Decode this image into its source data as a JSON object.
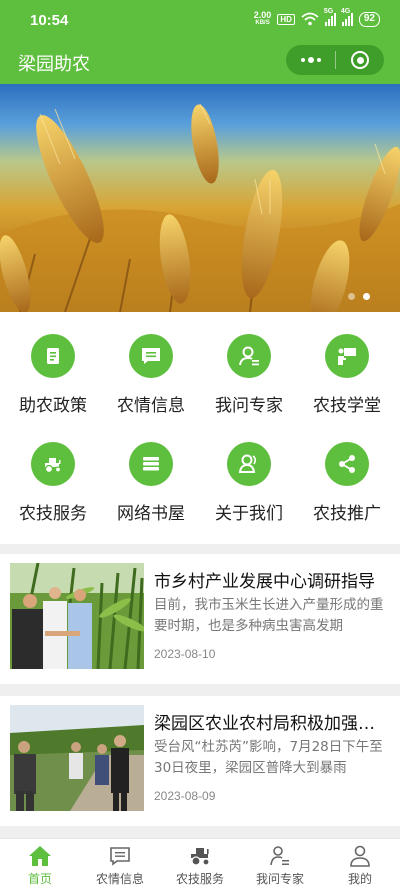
{
  "status_bar": {
    "time": "10:54",
    "speed_value": "2.00",
    "speed_unit": "KB/S",
    "hd_label": "HD",
    "signal1_label": "5G",
    "signal2_label": "4G",
    "battery": "92"
  },
  "header": {
    "title": "梁园助农",
    "more_icon": "more-dots-icon",
    "close_icon": "target-close-icon"
  },
  "banner": {
    "image": "wheat-field-photo",
    "slide_count": 2,
    "active_slide": 2
  },
  "grid_items": [
    {
      "label": "助农政策",
      "icon": "document-icon"
    },
    {
      "label": "农情信息",
      "icon": "message-icon"
    },
    {
      "label": "我问专家",
      "icon": "expert-icon"
    },
    {
      "label": "农技学堂",
      "icon": "teacher-icon"
    },
    {
      "label": "农技服务",
      "icon": "tractor-icon"
    },
    {
      "label": "网络书屋",
      "icon": "books-icon"
    },
    {
      "label": "关于我们",
      "icon": "users-icon"
    },
    {
      "label": "农技推广",
      "icon": "share-icon"
    }
  ],
  "news": [
    {
      "title": "市乡村产业发展中心调研指导",
      "summary": "目前，我市玉米生长进入产量形成的重要时期，也是多种病虫害高发期",
      "date": "2023-08-10",
      "image": "cornfield-inspection-photo"
    },
    {
      "title": "梁园区农业农村局积极加强防汛",
      "summary": "受台风“杜苏芮”影响，7月28日下午至30日夜里，梁园区普降大到暴雨",
      "date": "2023-08-09",
      "image": "flood-inspection-photo"
    }
  ],
  "tab_bar": {
    "active": "首页",
    "items": [
      {
        "label": "首页",
        "icon": "home-icon"
      },
      {
        "label": "农情信息",
        "icon": "message-icon"
      },
      {
        "label": "农技服务",
        "icon": "tractor-icon"
      },
      {
        "label": "我问专家",
        "icon": "expert-icon"
      },
      {
        "label": "我的",
        "icon": "person-icon"
      }
    ]
  },
  "colors": {
    "brand_green": "#5ebe3d",
    "capsule_green": "#3f9d2a",
    "text_dark": "#222222",
    "text_muted": "#777777",
    "divider": "#efefef"
  }
}
